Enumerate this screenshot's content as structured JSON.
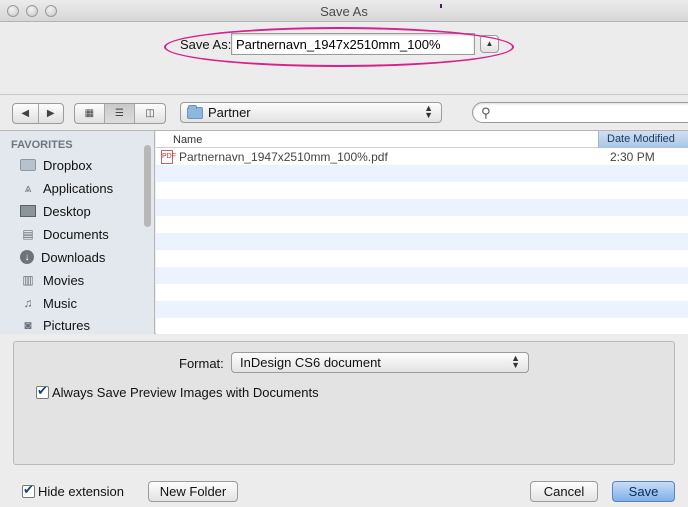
{
  "window": {
    "title": "Save As"
  },
  "save_row": {
    "label": "Save As:",
    "filename": "Partnernavn_1947x2510mm_100%",
    "expand_glyph": "▲"
  },
  "toolbar": {
    "location": "Partner",
    "search_placeholder": "",
    "search_glyph": "⚲"
  },
  "sidebar": {
    "heading": "FAVORITES",
    "items": [
      {
        "label": "Dropbox",
        "icon": "folder-icon"
      },
      {
        "label": "Applications",
        "icon": "applications-icon"
      },
      {
        "label": "Desktop",
        "icon": "desktop-icon"
      },
      {
        "label": "Documents",
        "icon": "documents-icon"
      },
      {
        "label": "Downloads",
        "icon": "downloads-icon"
      },
      {
        "label": "Movies",
        "icon": "movies-icon"
      },
      {
        "label": "Music",
        "icon": "music-icon"
      },
      {
        "label": "Pictures",
        "icon": "pictures-icon"
      }
    ]
  },
  "file_list": {
    "columns": {
      "name": "Name",
      "date": "Date Modified"
    },
    "rows": [
      {
        "name": "Partnernavn_1947x2510mm_100%.pdf",
        "date": "2:30 PM"
      }
    ]
  },
  "options": {
    "format_label": "Format:",
    "format_value": "InDesign CS6 document",
    "preview_label": "Always Save Preview Images with Documents",
    "preview_checked": true
  },
  "bottom": {
    "hide_extension_label": "Hide extension",
    "hide_extension_checked": true,
    "new_folder": "New Folder",
    "cancel": "Cancel",
    "save": "Save"
  },
  "colors": {
    "highlight": "#d81f8c",
    "accent": "#7eb0ea",
    "sidebar_bg": "#e3e8ee"
  }
}
